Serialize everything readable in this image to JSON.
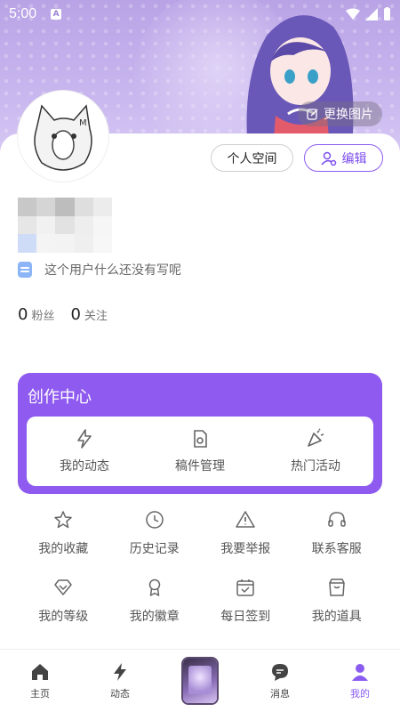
{
  "status_bar": {
    "time": "5:00",
    "badge": "A"
  },
  "header": {
    "change_bg_label": "更换图片"
  },
  "profile": {
    "space_button": "个人空间",
    "edit_button": "编辑",
    "bio": "这个用户什么还没有写呢",
    "fans_count": "0",
    "fans_label": "粉丝",
    "follow_count": "0",
    "follow_label": "关注"
  },
  "creation_center": {
    "title": "创作中心",
    "tools": [
      {
        "label": "我的动态",
        "icon": "lightning-icon"
      },
      {
        "label": "稿件管理",
        "icon": "file-gear-icon"
      },
      {
        "label": "热门活动",
        "icon": "party-popper-icon"
      }
    ]
  },
  "features": [
    {
      "label": "我的收藏",
      "icon": "star-icon"
    },
    {
      "label": "历史记录",
      "icon": "clock-icon"
    },
    {
      "label": "我要举报",
      "icon": "warning-icon"
    },
    {
      "label": "联系客服",
      "icon": "headset-icon"
    },
    {
      "label": "我的等级",
      "icon": "diamond-icon"
    },
    {
      "label": "我的徽章",
      "icon": "badge-icon"
    },
    {
      "label": "每日签到",
      "icon": "calendar-check-icon"
    },
    {
      "label": "我的道具",
      "icon": "bag-icon"
    }
  ],
  "tabbar": [
    {
      "label": "主页",
      "icon": "home-icon"
    },
    {
      "label": "动态",
      "icon": "lightning-icon"
    },
    {
      "label": "",
      "icon": "center-thumbnail"
    },
    {
      "label": "消息",
      "icon": "chat-icon"
    },
    {
      "label": "我的",
      "icon": "user-icon",
      "active": true
    }
  ],
  "colors": {
    "accent": "#8e5af0",
    "banner": "#b9a3e6"
  }
}
